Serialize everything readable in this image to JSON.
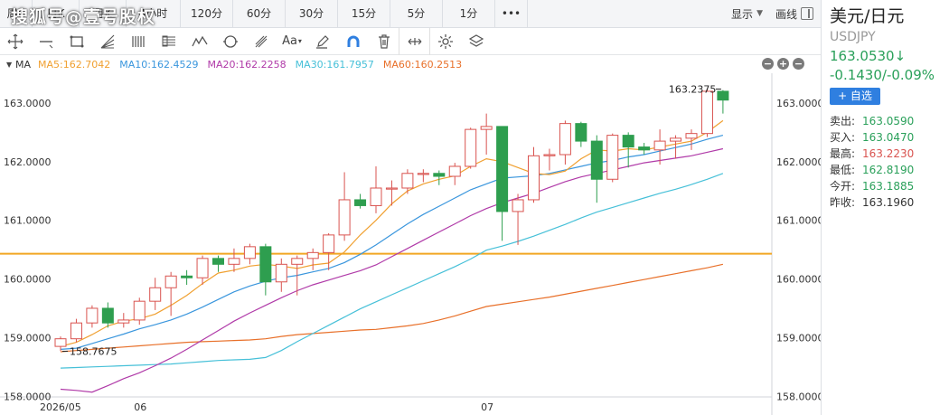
{
  "watermark": "搜狐号@壹号股权",
  "periods": [
    {
      "label": "周K",
      "w": 36,
      "active": false
    },
    {
      "label": "日K",
      "w": 52,
      "active": false
    },
    {
      "label": "月K",
      "w": 52,
      "active": false
    },
    {
      "label": "4小时",
      "w": 60,
      "active": false
    },
    {
      "label": "120分",
      "w": 58,
      "active": false
    },
    {
      "label": "60分",
      "w": 58,
      "active": false
    },
    {
      "label": "30分",
      "w": 58,
      "active": false
    },
    {
      "label": "15分",
      "w": 58,
      "active": false
    },
    {
      "label": "5分",
      "w": 58,
      "active": false
    },
    {
      "label": "1分",
      "w": 58,
      "active": false
    },
    {
      "label": "•••",
      "w": 36,
      "active": false
    }
  ],
  "toolbar_right": {
    "display_label": "显示",
    "draw_label": "画线"
  },
  "tools": [
    "crosshair-icon",
    "line-icon",
    "rect-icon",
    "fan-icon",
    "bars-icon",
    "fib-icon",
    "wave-icon",
    "cycle-icon",
    "pitchfork-icon",
    "text-icon",
    "pen-icon",
    "magnet-icon",
    "trash-icon",
    "arrows-icon",
    "settings-icon",
    "layers-icon"
  ],
  "ma": {
    "name": "MA",
    "items": [
      {
        "label": "MA5:162.7042",
        "color": "#f0a030"
      },
      {
        "label": "MA10:162.4529",
        "color": "#3a96dd"
      },
      {
        "label": "MA20:162.2258",
        "color": "#b03aa8"
      },
      {
        "label": "MA30:161.7957",
        "color": "#46c0d8"
      },
      {
        "label": "MA60:160.2513",
        "color": "#e8702a"
      }
    ],
    "ctrls": [
      "−",
      "+",
      "−"
    ]
  },
  "chart_data": {
    "type": "candlestick",
    "ylim": [
      157.95,
      163.5
    ],
    "y_ticks": [
      "163.0000",
      "162.0000",
      "161.0000",
      "160.0000",
      "159.0000",
      "158.0000"
    ],
    "y_tick_values": [
      163,
      162,
      161,
      160,
      159,
      158
    ],
    "x_labels": [
      {
        "text": "2026/05",
        "index": 0
      },
      {
        "text": "06",
        "index": 5
      },
      {
        "text": "07",
        "index": 27
      }
    ],
    "up_color": "#d9534f",
    "down_color": "#2e9e4f",
    "hline": {
      "value": 160.43,
      "color": "#f2a623"
    },
    "annotation_high": {
      "text": "163.2375",
      "value": 163.2375,
      "index": 42
    },
    "annotation_low": {
      "text": "158.7675",
      "value": 158.7675,
      "index": 0
    },
    "candles": [
      [
        158.85,
        158.98,
        159.02,
        158.77
      ],
      [
        158.98,
        159.25,
        159.32,
        158.92
      ],
      [
        159.25,
        159.5,
        159.55,
        159.17
      ],
      [
        159.5,
        159.25,
        159.6,
        159.17
      ],
      [
        159.25,
        159.3,
        159.42,
        159.17
      ],
      [
        159.3,
        159.62,
        159.68,
        159.22
      ],
      [
        159.62,
        159.85,
        160.02,
        159.47
      ],
      [
        159.85,
        160.05,
        160.12,
        159.37
      ],
      [
        160.05,
        160.02,
        160.15,
        159.9
      ],
      [
        160.02,
        160.35,
        160.4,
        159.9
      ],
      [
        160.35,
        160.25,
        160.4,
        160.12
      ],
      [
        160.25,
        160.35,
        160.52,
        160.12
      ],
      [
        160.35,
        160.55,
        160.6,
        160.25
      ],
      [
        160.55,
        159.95,
        160.6,
        159.72
      ],
      [
        159.95,
        160.25,
        160.35,
        159.78
      ],
      [
        160.25,
        160.35,
        160.4,
        159.72
      ],
      [
        160.35,
        160.45,
        160.52,
        160.15
      ],
      [
        160.45,
        160.75,
        160.78,
        160.15
      ],
      [
        160.75,
        161.35,
        161.82,
        160.65
      ],
      [
        161.35,
        161.25,
        161.45,
        161.2
      ],
      [
        161.25,
        161.55,
        161.92,
        161.12
      ],
      [
        161.55,
        161.55,
        161.68,
        161.25
      ],
      [
        161.55,
        161.8,
        161.87,
        161.45
      ],
      [
        161.8,
        161.8,
        161.87,
        161.65
      ],
      [
        161.8,
        161.75,
        161.85,
        161.6
      ],
      [
        161.75,
        161.92,
        161.98,
        161.6
      ],
      [
        161.92,
        162.55,
        162.58,
        161.88
      ],
      [
        162.55,
        162.6,
        162.82,
        162.12
      ],
      [
        162.6,
        161.15,
        162.6,
        160.65
      ],
      [
        161.15,
        161.35,
        161.45,
        160.58
      ],
      [
        161.35,
        162.1,
        162.25,
        161.3
      ],
      [
        162.1,
        162.12,
        162.22,
        161.85
      ],
      [
        162.12,
        162.65,
        162.7,
        161.95
      ],
      [
        162.65,
        162.35,
        162.68,
        162.25
      ],
      [
        162.35,
        161.7,
        162.45,
        161.3
      ],
      [
        161.7,
        162.45,
        162.48,
        161.65
      ],
      [
        162.45,
        162.25,
        162.5,
        161.9
      ],
      [
        162.25,
        162.2,
        162.32,
        162.12
      ],
      [
        162.2,
        162.35,
        162.55,
        161.95
      ],
      [
        162.35,
        162.4,
        162.45,
        162.05
      ],
      [
        162.4,
        162.48,
        162.55,
        162.2
      ],
      [
        162.48,
        163.2,
        163.24,
        162.42
      ],
      [
        163.2,
        163.05,
        163.22,
        162.82
      ]
    ],
    "ma5": [
      158.85,
      158.92,
      159.05,
      159.2,
      159.28,
      159.32,
      159.4,
      159.55,
      159.72,
      159.92,
      160.1,
      160.15,
      160.22,
      160.25,
      160.22,
      160.18,
      160.24,
      160.27,
      160.46,
      160.75,
      161.0,
      161.28,
      161.5,
      161.62,
      161.7,
      161.76,
      161.92,
      162.05,
      162.0,
      161.9,
      161.8,
      161.78,
      161.84,
      162.05,
      162.2,
      162.18,
      162.22,
      162.2,
      162.25,
      162.3,
      162.35,
      162.5,
      162.7
    ],
    "ma10": [
      158.8,
      158.82,
      158.9,
      158.98,
      159.06,
      159.15,
      159.22,
      159.3,
      159.4,
      159.52,
      159.65,
      159.78,
      159.88,
      159.96,
      160.02,
      160.06,
      160.12,
      160.18,
      160.28,
      160.42,
      160.58,
      160.76,
      160.94,
      161.1,
      161.24,
      161.38,
      161.52,
      161.62,
      161.72,
      161.74,
      161.76,
      161.8,
      161.86,
      161.92,
      161.98,
      162.02,
      162.08,
      162.12,
      162.18,
      162.24,
      162.3,
      162.38,
      162.45
    ],
    "ma20": [
      158.12,
      158.1,
      158.07,
      158.18,
      158.3,
      158.4,
      158.52,
      158.65,
      158.8,
      158.96,
      159.12,
      159.28,
      159.42,
      159.55,
      159.68,
      159.8,
      159.9,
      159.98,
      160.06,
      160.14,
      160.24,
      160.38,
      160.52,
      160.66,
      160.8,
      160.94,
      161.08,
      161.2,
      161.3,
      161.38,
      161.46,
      161.56,
      161.66,
      161.74,
      161.8,
      161.86,
      161.92,
      161.98,
      162.02,
      162.06,
      162.1,
      162.16,
      162.22
    ],
    "ma30": [
      158.48,
      158.49,
      158.5,
      158.51,
      158.52,
      158.53,
      158.54,
      158.55,
      158.57,
      158.59,
      158.61,
      158.62,
      158.63,
      158.66,
      158.78,
      158.93,
      159.07,
      159.21,
      159.35,
      159.49,
      159.61,
      159.73,
      159.85,
      159.97,
      160.09,
      160.21,
      160.34,
      160.49,
      160.56,
      160.64,
      160.73,
      160.83,
      160.93,
      161.04,
      161.14,
      161.22,
      161.3,
      161.38,
      161.46,
      161.53,
      161.61,
      161.7,
      161.8
    ],
    "ma60": [
      158.76,
      158.78,
      158.8,
      158.82,
      158.84,
      158.86,
      158.88,
      158.9,
      158.92,
      158.93,
      158.94,
      158.95,
      158.96,
      158.98,
      159.02,
      159.05,
      159.07,
      159.09,
      159.11,
      159.13,
      159.14,
      159.17,
      159.2,
      159.24,
      159.3,
      159.37,
      159.45,
      159.53,
      159.57,
      159.61,
      159.65,
      159.69,
      159.74,
      159.79,
      159.84,
      159.89,
      159.94,
      159.99,
      160.04,
      160.09,
      160.14,
      160.19,
      160.25
    ]
  },
  "side": {
    "name": "美元/日元",
    "code": "USDJPY",
    "price": "163.0530↓",
    "change": "-0.1430/-0.09%",
    "watch_label": "+ 自选",
    "quotes": [
      {
        "label": "卖出:",
        "value": "163.0590",
        "color": "#2aa05a"
      },
      {
        "label": "买入:",
        "value": "163.0470",
        "color": "#2aa05a"
      },
      {
        "label": "最高:",
        "value": "163.2230",
        "color": "#d9534f"
      },
      {
        "label": "最低:",
        "value": "162.8190",
        "color": "#2aa05a"
      },
      {
        "label": "今开:",
        "value": "163.1885",
        "color": "#2aa05a"
      },
      {
        "label": "昨收:",
        "value": "163.1960",
        "color": "#333333"
      }
    ]
  }
}
